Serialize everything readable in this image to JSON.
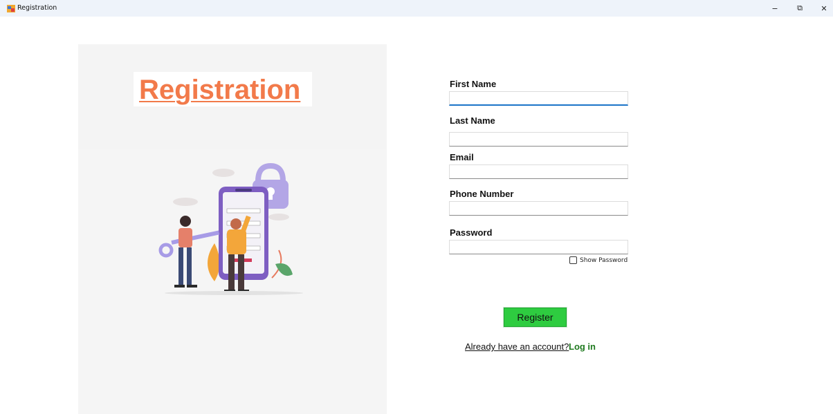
{
  "window": {
    "title": "Registration",
    "controls": {
      "minimize": "−",
      "maximize": "⧉",
      "close": "✕"
    }
  },
  "left_panel": {
    "heading": "Registration",
    "illustration": "registration-form-illustration"
  },
  "form": {
    "first_name_label": "First Name",
    "first_name_value": "",
    "last_name_label": "Last Name",
    "last_name_value": "",
    "email_label": "Email",
    "email_value": "",
    "phone_label": "Phone Number",
    "phone_value": "",
    "password_label": "Password",
    "password_value": "",
    "show_password_label": "Show Password",
    "show_password_checked": false,
    "register_label": "Register",
    "account_text": "Already have an account?",
    "login_label": "Log in"
  },
  "colors": {
    "heading": "#f27a4a",
    "register_button": "#2ecc40",
    "login_link": "#1f7a1f",
    "focus_underline": "#1a73c8"
  }
}
